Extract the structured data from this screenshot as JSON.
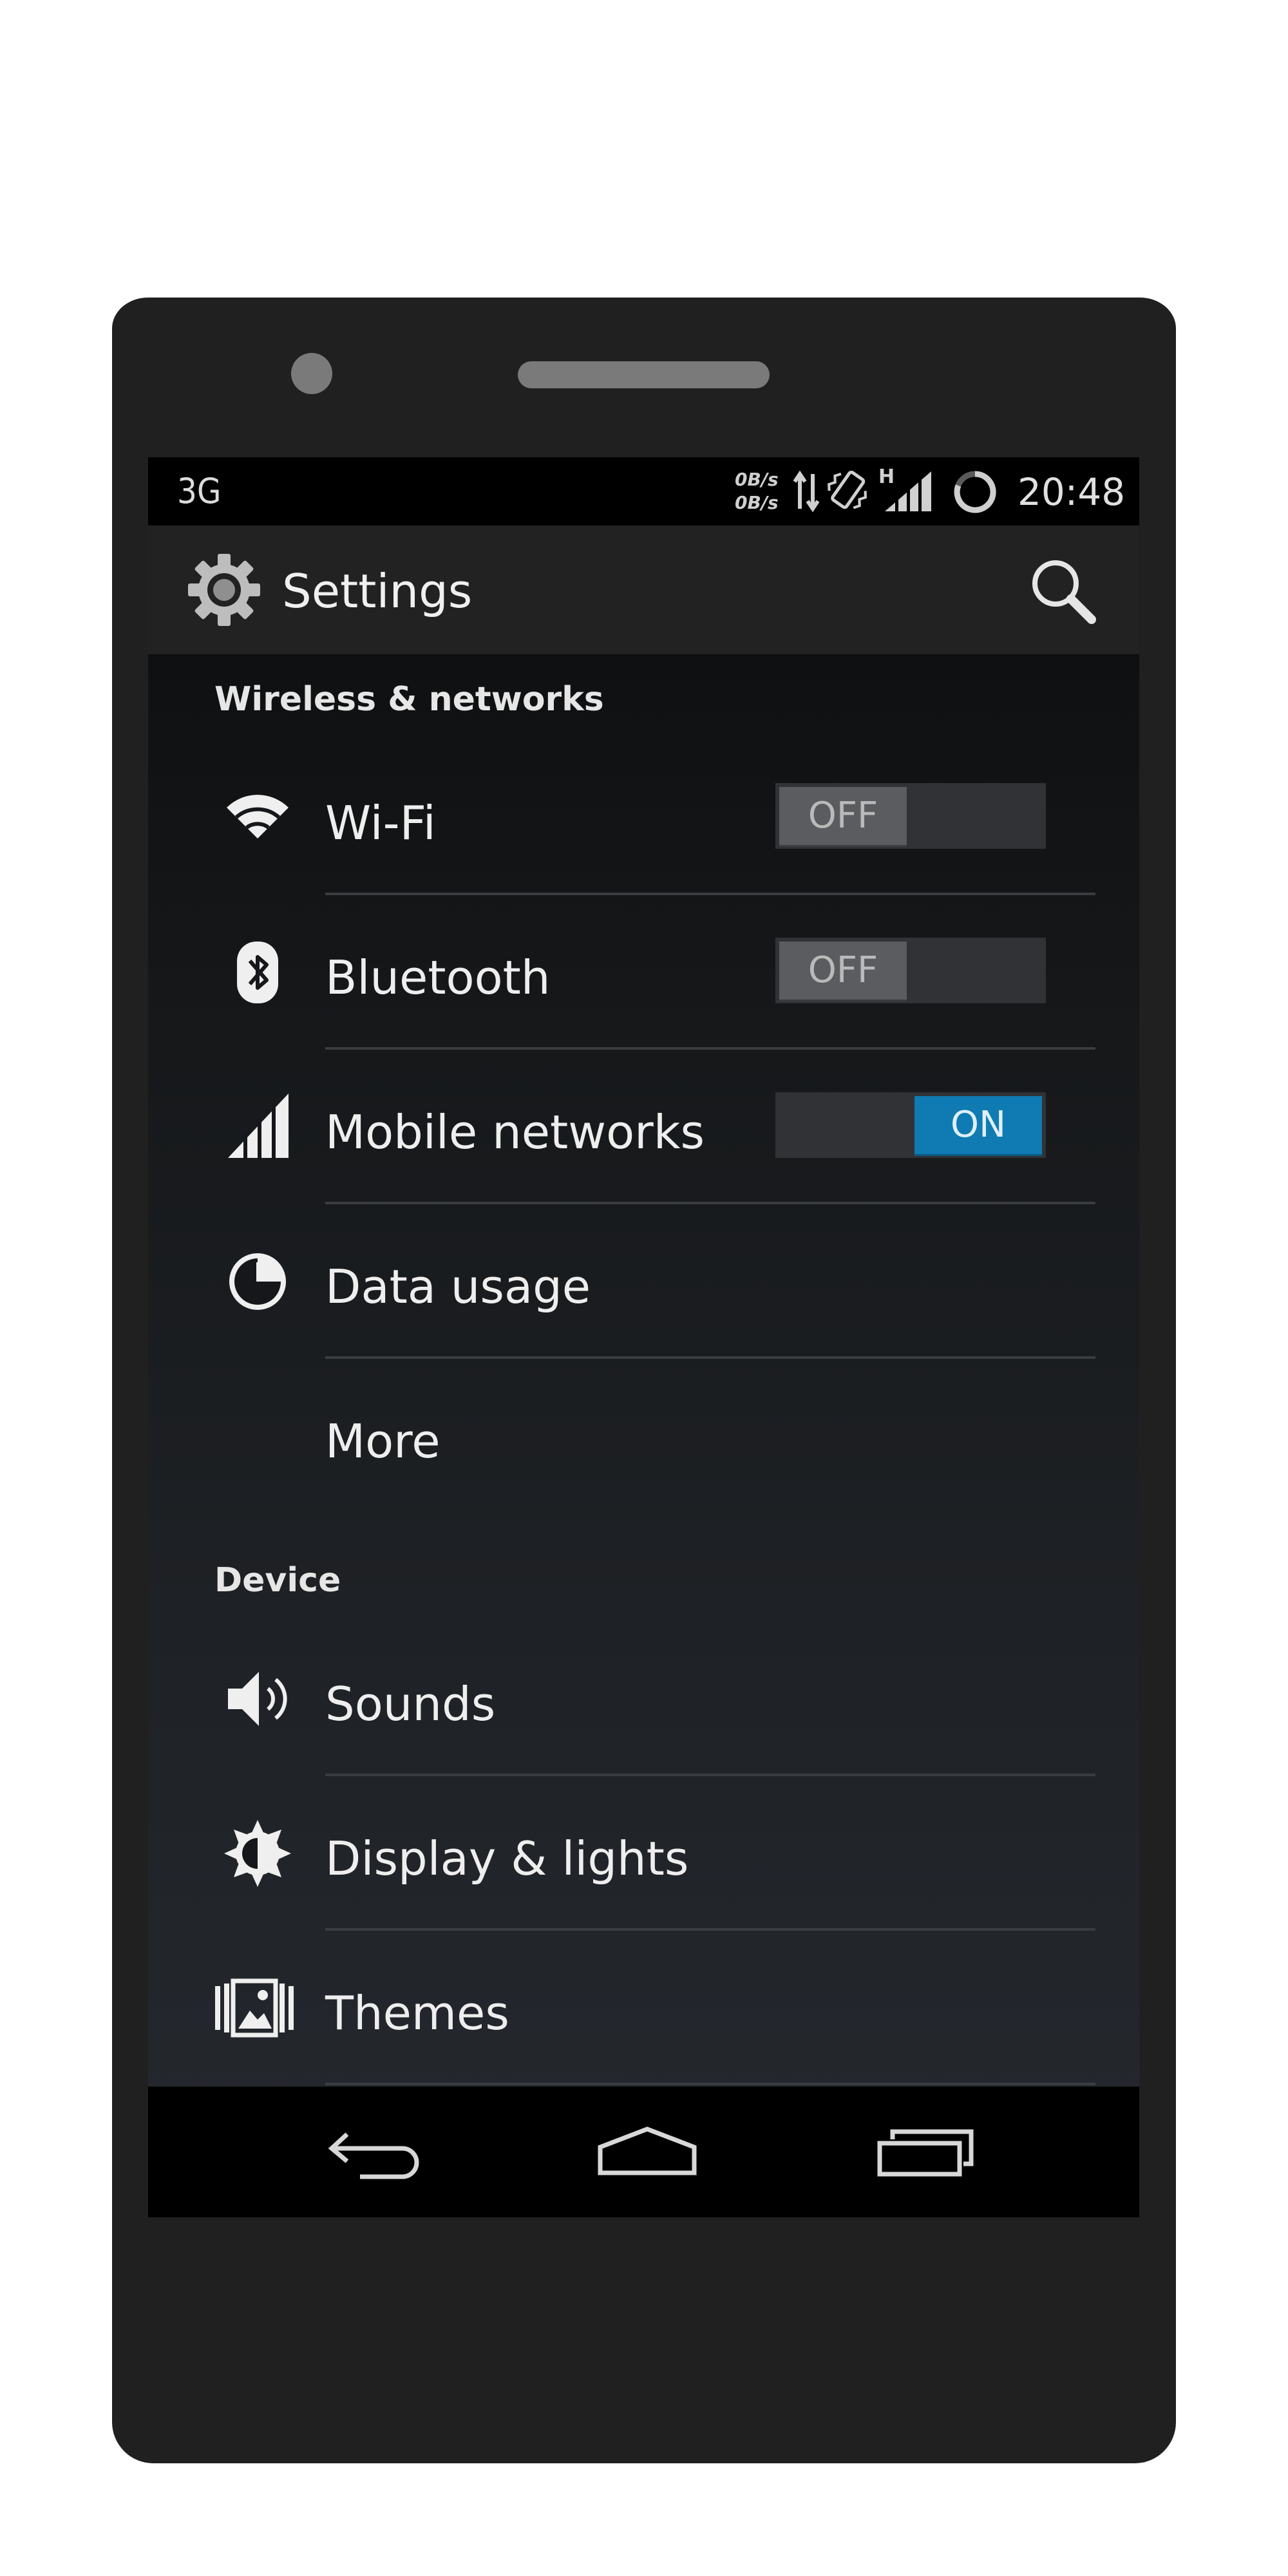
{
  "status_bar": {
    "network_type": "3G",
    "upload_rate": "0B/s",
    "download_rate": "0B/s",
    "signal_type": "H",
    "time": "20:48",
    "icons": [
      "data-transfer-icon",
      "vibrate-icon",
      "signal-icon",
      "battery-ring-icon"
    ]
  },
  "action_bar": {
    "title": "Settings",
    "icon": "settings-gear-icon",
    "search_icon": "search-icon"
  },
  "sections": {
    "wireless": {
      "header": "Wireless & networks",
      "items": [
        {
          "label": "Wi-Fi",
          "icon": "wifi-icon",
          "toggle": "OFF"
        },
        {
          "label": "Bluetooth",
          "icon": "bluetooth-icon",
          "toggle": "OFF"
        },
        {
          "label": "Mobile networks",
          "icon": "signal-bars-icon",
          "toggle": "ON"
        },
        {
          "label": "Data usage",
          "icon": "data-usage-icon"
        },
        {
          "label": "More"
        }
      ]
    },
    "device": {
      "header": "Device",
      "items": [
        {
          "label": "Sounds",
          "icon": "speaker-icon"
        },
        {
          "label": "Display & lights",
          "icon": "brightness-icon"
        },
        {
          "label": "Themes",
          "icon": "themes-icon"
        }
      ]
    }
  },
  "nav_bar": {
    "buttons": [
      "back-icon",
      "home-icon",
      "recents-icon"
    ]
  },
  "colors": {
    "accent_on": "#0f7bb2",
    "toggle_off": "#5a5c60",
    "phone_body": "#202020"
  }
}
